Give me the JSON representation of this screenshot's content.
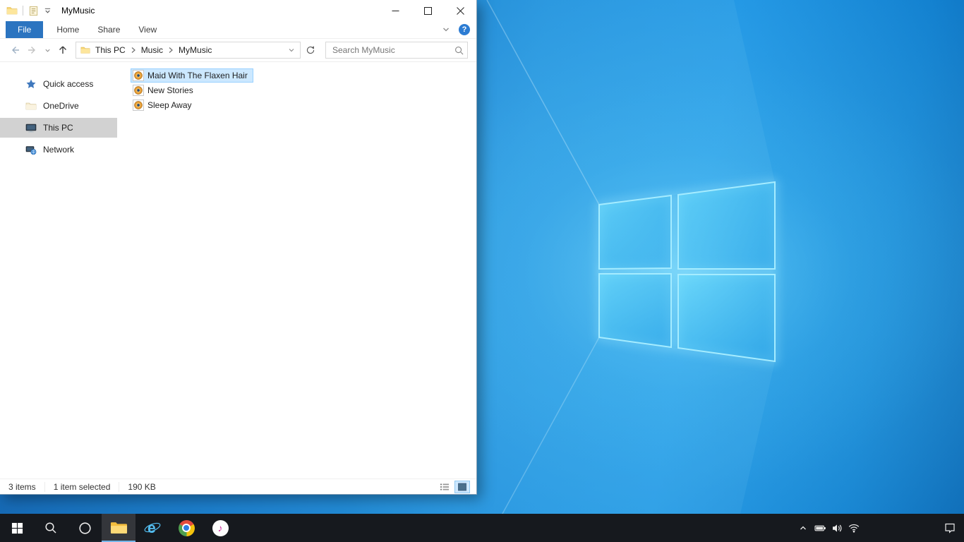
{
  "explorer": {
    "title": "MyMusic",
    "ribbon": {
      "tabs": [
        {
          "label": "File"
        },
        {
          "label": "Home"
        },
        {
          "label": "Share"
        },
        {
          "label": "View"
        }
      ],
      "help_glyph": "?"
    },
    "addressbar": {
      "breadcrumb": [
        {
          "label": "This PC"
        },
        {
          "label": "Music"
        },
        {
          "label": "MyMusic"
        }
      ],
      "search_placeholder": "Search MyMusic"
    },
    "sidebar": {
      "items": [
        {
          "label": "Quick access",
          "icon": "quick-access-star"
        },
        {
          "label": "OneDrive",
          "icon": "onedrive-folder"
        },
        {
          "label": "This PC",
          "icon": "computer-monitor",
          "selected": true
        },
        {
          "label": "Network",
          "icon": "network-computers"
        }
      ]
    },
    "files": [
      {
        "name": "Maid With The Flaxen Hair",
        "icon": "music-file",
        "selected": true
      },
      {
        "name": "New Stories",
        "icon": "music-file"
      },
      {
        "name": "Sleep Away",
        "icon": "music-file"
      }
    ],
    "statusbar": {
      "count": "3 items",
      "selection": "1 item selected",
      "size": "190 KB"
    }
  },
  "taskbar": {
    "ie_glyph": "e",
    "itunes_glyph": "♪",
    "buttons": [
      "start",
      "search",
      "cortana",
      "file-explorer",
      "internet-explorer",
      "chrome",
      "itunes"
    ],
    "tray": [
      "hidden-icons-chevron",
      "battery",
      "volume",
      "wifi",
      "action-center"
    ],
    "file_explorer_active": true
  },
  "colors": {
    "file_tab_blue": "#2b74c0",
    "selection_bg": "#cce8ff",
    "selection_border": "#99d1ff",
    "sidebar_selected": "#d2d2d2",
    "taskbar_bg": "#16191e",
    "wallpaper_base": "#1e8fdc",
    "logo_pane": "#56d0f8"
  }
}
